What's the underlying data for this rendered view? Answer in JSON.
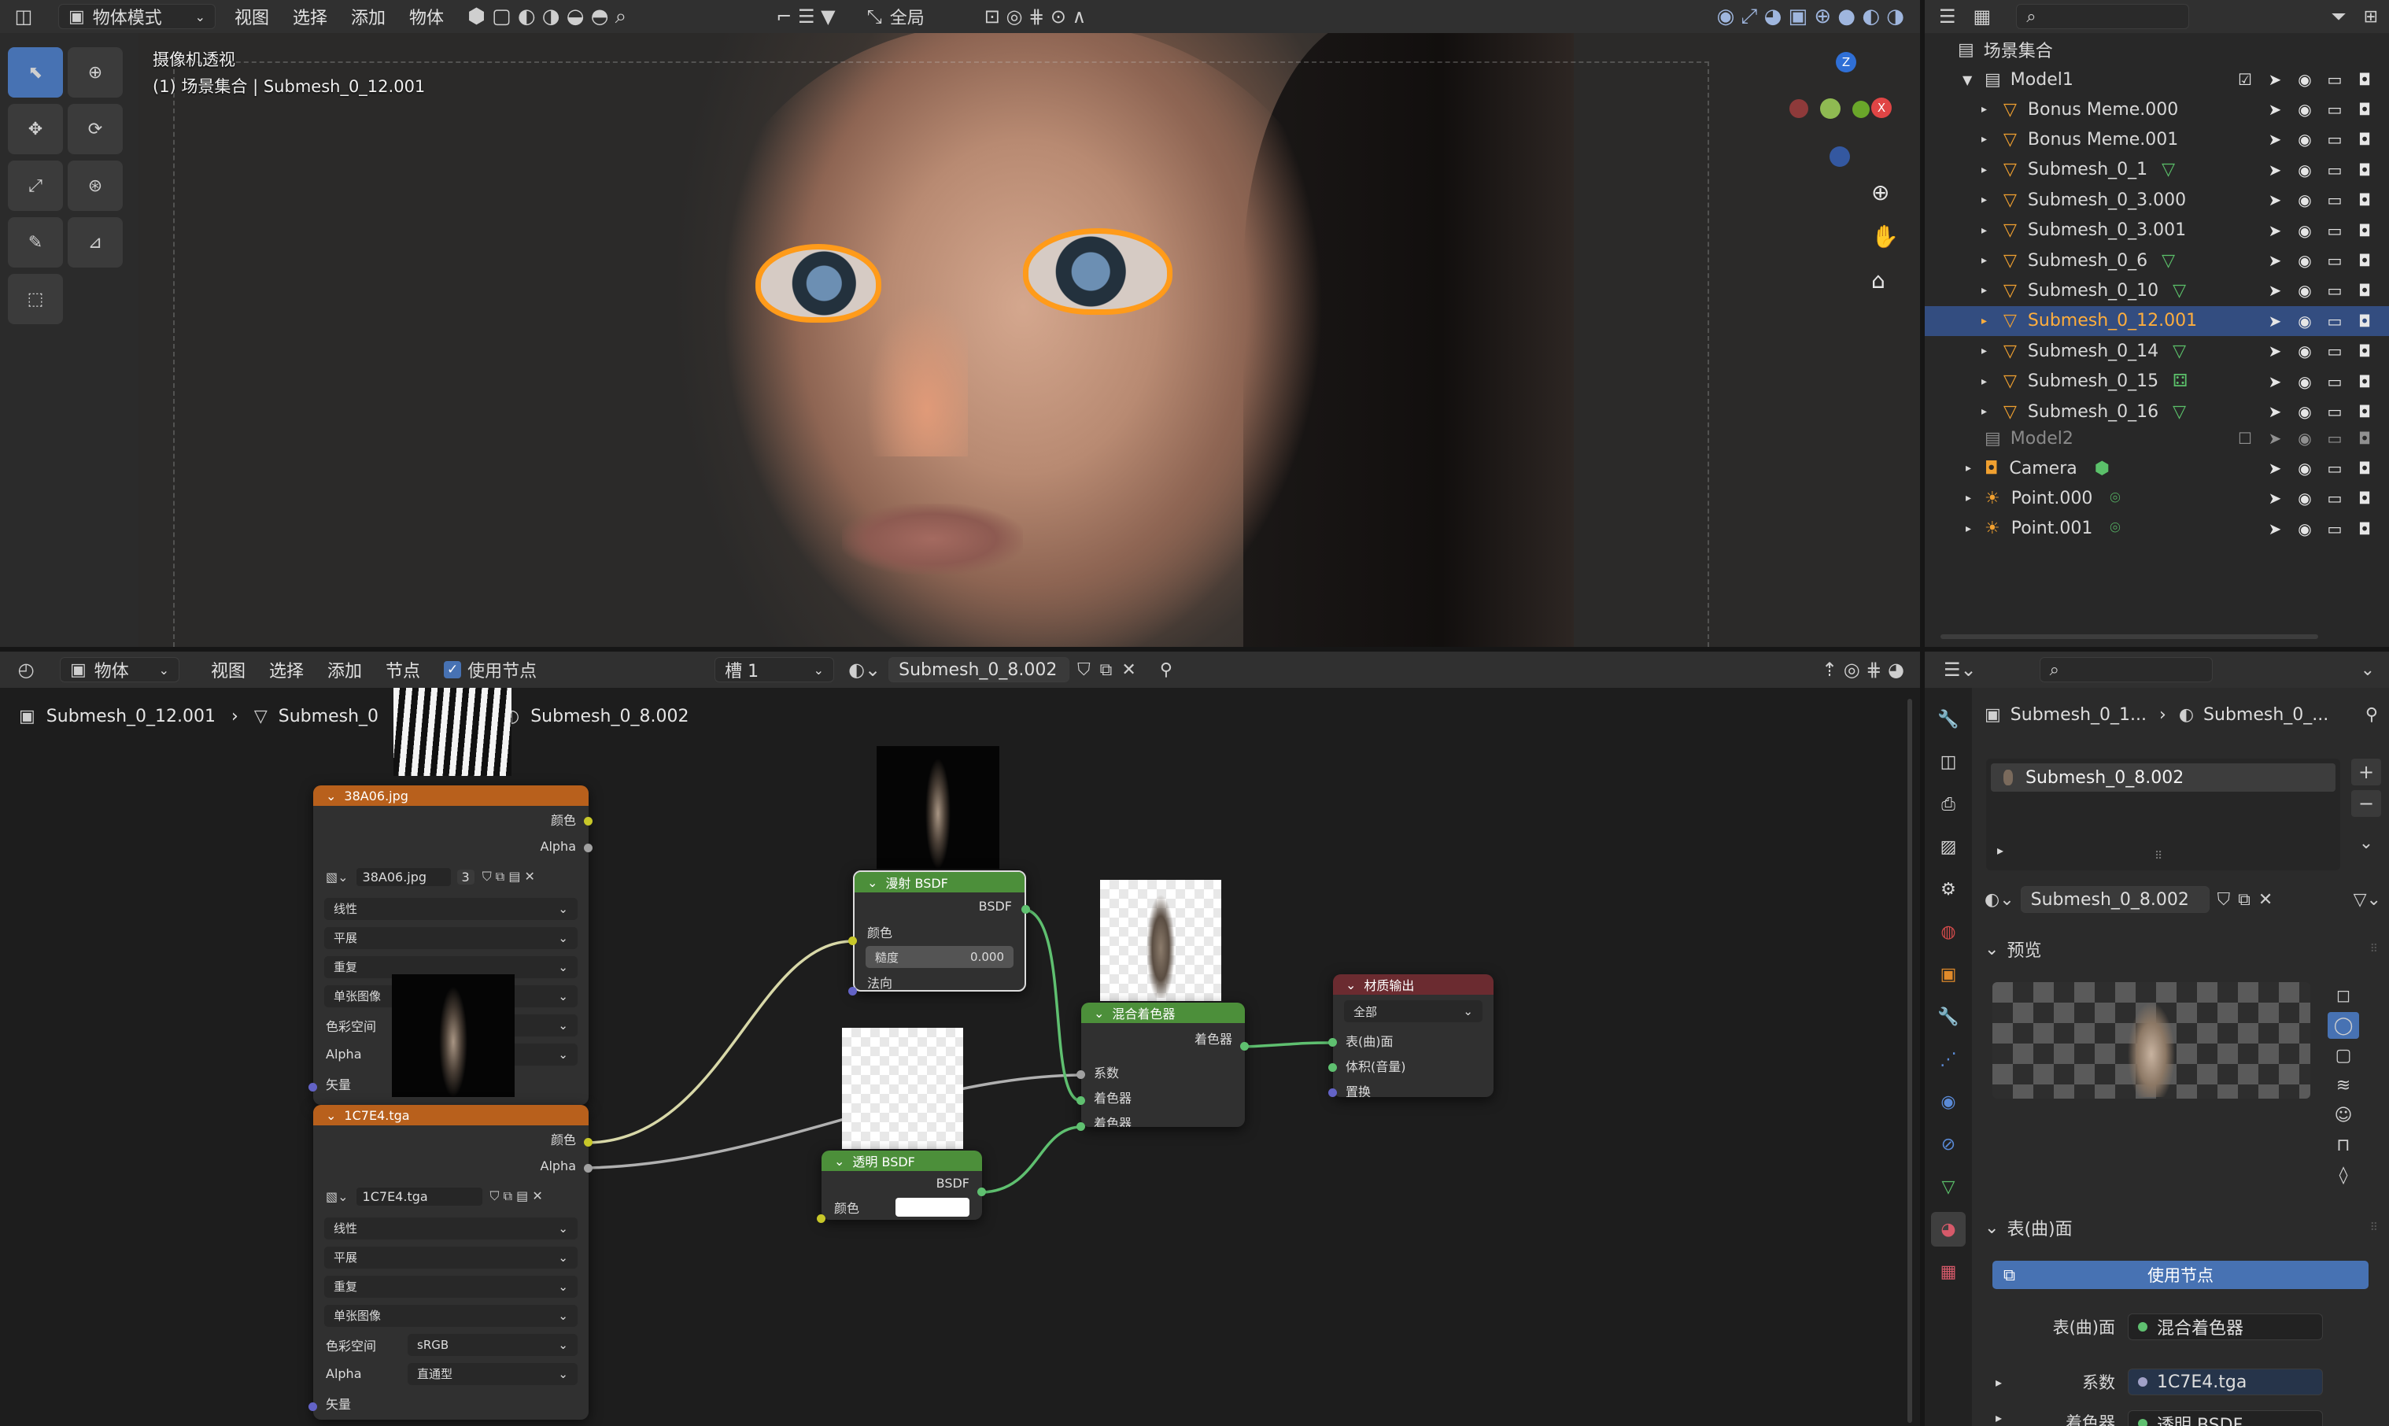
{
  "colors": {
    "accent": "#4772b3",
    "selection_orange": "#ff9b1a",
    "shader_green": "#4c8f3a",
    "image_orange": "#c2661a",
    "output_red": "#6b2b30"
  },
  "viewport": {
    "mode_label": "物体模式",
    "menu": [
      "视图",
      "选择",
      "添加",
      "物体"
    ],
    "transform_orientation": "全局",
    "overlay_line1": "摄像机透视",
    "overlay_line2": "(1) 场景集合 | Submesh_0_12.001"
  },
  "outliner": {
    "root": "场景集合",
    "collections": [
      {
        "name": "Model1",
        "items": [
          "Bonus Meme.000",
          "Bonus Meme.001",
          "Submesh_0_1",
          "Submesh_0_3.000",
          "Submesh_0_3.001",
          "Submesh_0_6",
          "Submesh_0_10",
          "Submesh_0_12.001",
          "Submesh_0_14",
          "Submesh_0_15",
          "Submesh_0_16"
        ],
        "selected": "Submesh_0_12.001"
      },
      {
        "name": "Model2",
        "items": []
      }
    ],
    "objects": [
      "Camera",
      "Point.000",
      "Point.001"
    ]
  },
  "node_editor": {
    "editor_mode": "物体",
    "menu": [
      "视图",
      "选择",
      "添加",
      "节点"
    ],
    "use_nodes_label": "使用节点",
    "slot": "槽 1",
    "material": "Submesh_0_8.002",
    "breadcrumb": [
      "Submesh_0_12.001",
      "Submesh_0",
      "Submesh_0_8.002"
    ],
    "nodes": {
      "img1": {
        "title": "38A06.jpg",
        "out_color": "颜色",
        "out_alpha": "Alpha",
        "file": "38A06.jpg",
        "users": "3",
        "interp": "线性",
        "proj": "平展",
        "ext": "重复",
        "source": "单张图像",
        "colorspace_label": "色彩空间",
        "alpha_label": "Alpha",
        "vector": "矢量"
      },
      "img2": {
        "title": "1C7E4.tga",
        "out_color": "颜色",
        "out_alpha": "Alpha",
        "file": "1C7E4.tga",
        "interp": "线性",
        "proj": "平展",
        "ext": "重复",
        "source": "单张图像",
        "colorspace_label": "色彩空间",
        "colorspace": "sRGB",
        "alpha_label": "Alpha",
        "alpha": "直通型",
        "vector": "矢量"
      },
      "diffuse": {
        "title": "漫射 BSDF",
        "out": "BSDF",
        "color": "颜色",
        "roughness_label": "糙度",
        "roughness": "0.000",
        "normal": "法向"
      },
      "transparent": {
        "title": "透明 BSDF",
        "out": "BSDF",
        "color": "颜色"
      },
      "mix": {
        "title": "混合着色器",
        "out": "着色器",
        "fac": "系数",
        "shader1": "着色器",
        "shader2": "着色器"
      },
      "output": {
        "title": "材质输出",
        "target": "全部",
        "surface": "表(曲)面",
        "volume": "体积(音量)",
        "displacement": "置换"
      }
    }
  },
  "properties": {
    "breadcrumb": [
      "Submesh_0_1...",
      "Submesh_0_..."
    ],
    "slot_item": "Submesh_0_8.002",
    "material_name": "Submesh_0_8.002",
    "preview_label": "预览",
    "surface_label": "表(曲)面",
    "use_nodes_button": "使用节点",
    "surface_row_label": "表(曲)面",
    "surface_value": "混合着色器",
    "fac_label": "系数",
    "fac_value": "1C7E4.tga",
    "shader_label": "着色器",
    "shader_value": "透明 BSDF"
  }
}
